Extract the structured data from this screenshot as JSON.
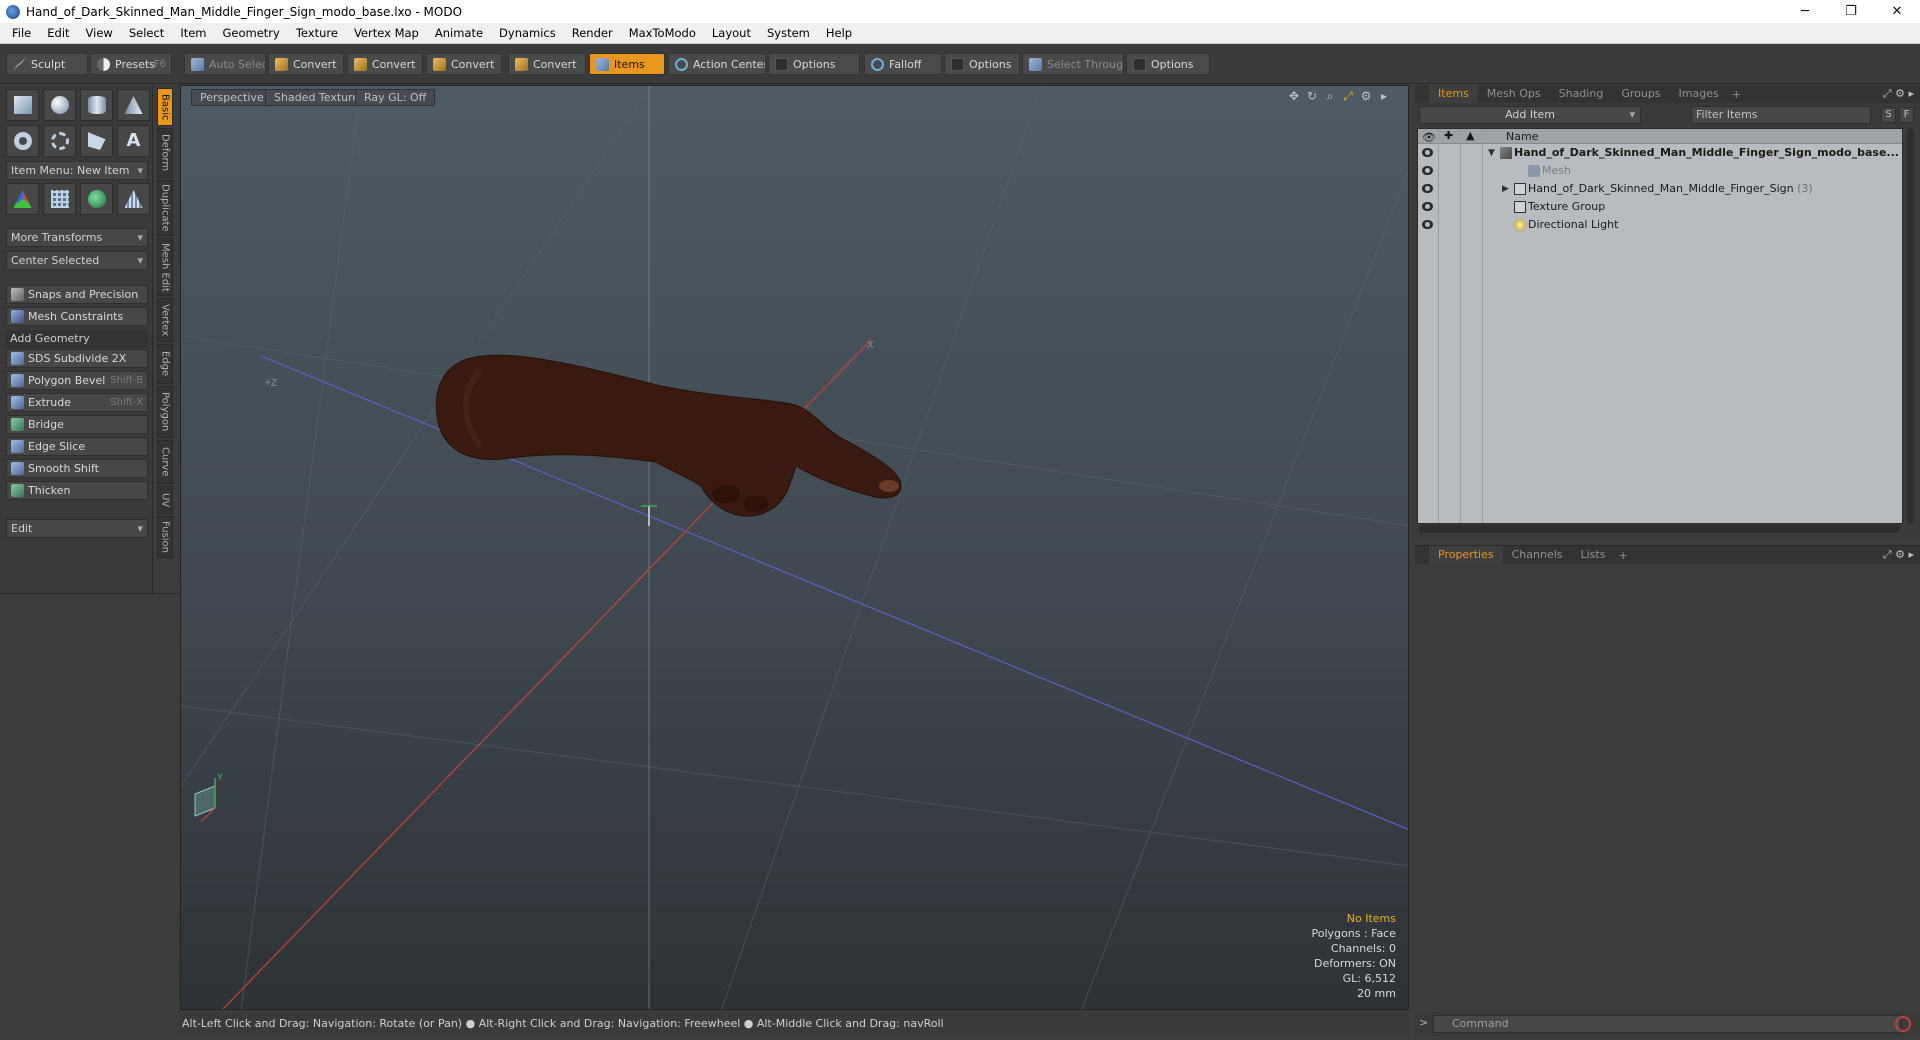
{
  "window": {
    "title": "Hand_of_Dark_Skinned_Man_Middle_Finger_Sign_modo_base.lxo - MODO",
    "minimize": "─",
    "maximize": "❐",
    "close": "✕"
  },
  "menu": [
    "File",
    "Edit",
    "View",
    "Select",
    "Item",
    "Geometry",
    "Texture",
    "Vertex Map",
    "Animate",
    "Dynamics",
    "Render",
    "MaxToModo",
    "Layout",
    "System",
    "Help"
  ],
  "toolbar": {
    "sculpt": "Sculpt",
    "presets": "Presets",
    "presets_key": "F6",
    "auto_select": "Auto Select",
    "convert1": "Convert",
    "convert2": "Convert",
    "convert3": "Convert",
    "convert4": "Convert",
    "items": "Items",
    "action_center": "Action Center",
    "options1": "Options",
    "falloff": "Falloff",
    "options2": "Options",
    "select_through": "Select Through",
    "options3": "Options"
  },
  "left_panel": {
    "item_menu": "Item Menu: New Item",
    "more_transforms": "More Transforms",
    "center_selected": "Center Selected",
    "snaps": "Snaps and Precision",
    "mesh_constraints": "Mesh Constraints",
    "add_geometry": "Add Geometry",
    "tools": [
      {
        "label": "SDS Subdivide 2X",
        "key": ""
      },
      {
        "label": "Polygon Bevel",
        "key": "Shift-B"
      },
      {
        "label": "Extrude",
        "key": "Shift-X"
      },
      {
        "label": "Bridge",
        "key": ""
      },
      {
        "label": "Edge Slice",
        "key": ""
      },
      {
        "label": "Smooth Shift",
        "key": ""
      },
      {
        "label": "Thicken",
        "key": ""
      }
    ],
    "edit": "Edit",
    "vtabs": [
      "Basic",
      "Deform",
      "Duplicate",
      "Mesh Edit",
      "Vertex",
      "Edge",
      "Polygon",
      "Curve",
      "UV",
      "Fusion"
    ]
  },
  "viewport": {
    "perspective": "Perspective",
    "shaded_texture": "Shaded Texture",
    "ray_gl": "Ray GL: Off",
    "hud": {
      "no_items": "No Items",
      "polygons": "Polygons : Face",
      "channels": "Channels: 0",
      "deformers": "Deformers: ON",
      "gl": "GL: 6,512",
      "scale": "20 mm"
    },
    "axis_labels": {
      "pz": "+Z",
      "px": "X",
      "y": "Y"
    }
  },
  "status": "Alt-Left Click and Drag: Navigation: Rotate (or Pan) ● Alt-Right Click and Drag: Navigation: Freewheel ● Alt-Middle Click and Drag: navRoll",
  "items_panel": {
    "tabs": [
      "Items",
      "Mesh Ops",
      "Shading",
      "Groups",
      "Images"
    ],
    "add_item": "Add Item",
    "filter_items": "Filter Items",
    "s_btn": "S",
    "f_btn": "F",
    "col_name": "Name",
    "rows": [
      {
        "label": "Hand_of_Dark_Skinned_Man_Middle_Finger_Sign_modo_base...",
        "count": ""
      },
      {
        "label": "Mesh",
        "count": ""
      },
      {
        "label": "Hand_of_Dark_Skinned_Man_Middle_Finger_Sign",
        "count": "(3)"
      },
      {
        "label": "Texture Group",
        "count": ""
      },
      {
        "label": "Directional Light",
        "count": ""
      }
    ]
  },
  "props_panel": {
    "tabs": [
      "Properties",
      "Channels",
      "Lists"
    ]
  },
  "command": {
    "placeholder": "Command"
  },
  "colors": {
    "accent": "#e8961c",
    "skin": "#3a1a10",
    "axis_x": "#c84040",
    "axis_z": "#5a60c8"
  }
}
